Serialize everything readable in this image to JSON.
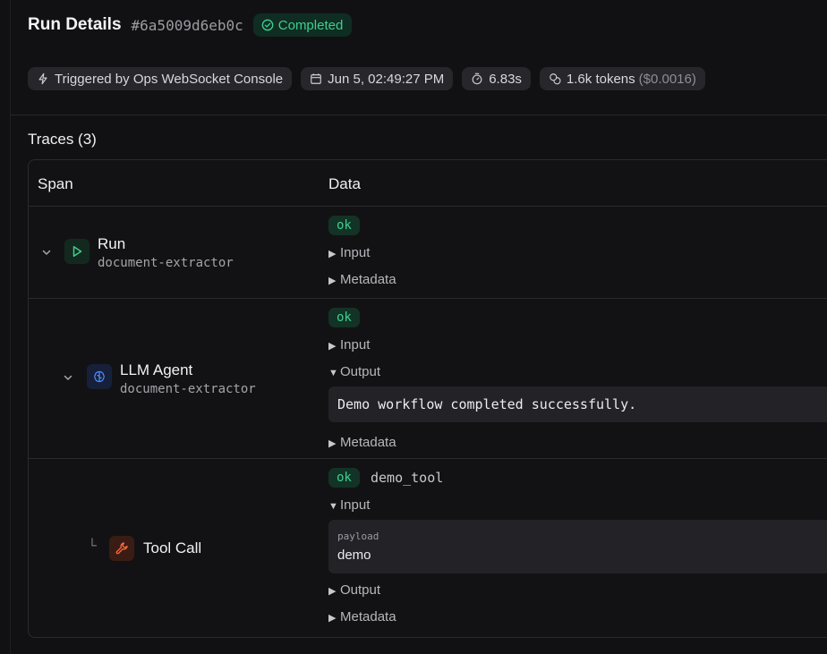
{
  "header": {
    "title": "Run Details",
    "run_id": "#6a5009d6eb0c",
    "status": "Completed"
  },
  "chips": {
    "trigger": "Triggered by Ops WebSocket Console",
    "date": "Jun 5, 02:49:27 PM",
    "duration": "6.83s",
    "tokens": "1.6k tokens",
    "cost": "($0.0016)"
  },
  "traces": {
    "title": "Traces (3)",
    "col_span": "Span",
    "col_data": "Data",
    "spans": [
      {
        "name": "Run",
        "subtitle": "document-extractor",
        "status": "ok",
        "input_label": "Input",
        "metadata_label": "Metadata"
      },
      {
        "name": "LLM Agent",
        "subtitle": "document-extractor",
        "status": "ok",
        "input_label": "Input",
        "output_label": "Output",
        "output_text": "Demo workflow completed successfully.",
        "metadata_label": "Metadata"
      },
      {
        "name": "Tool Call",
        "status": "ok",
        "tool_name": "demo_tool",
        "input_label": "Input",
        "payload_key": "payload",
        "payload_value": "demo",
        "output_label": "Output",
        "metadata_label": "Metadata"
      }
    ]
  },
  "colors": {
    "accent_green": "#3ecf8e",
    "run_icon": "#3ecf8e",
    "agent_icon": "#4c8dff",
    "tool_icon": "#ff6a3d"
  },
  "icons": {
    "status": "check-circle-icon",
    "trigger": "lightning-icon",
    "date": "calendar-icon",
    "duration": "timer-icon",
    "tokens": "coins-icon",
    "run": "play-icon",
    "agent": "brain-icon",
    "tool": "wrench-icon",
    "expand": "chevron-down-icon"
  }
}
